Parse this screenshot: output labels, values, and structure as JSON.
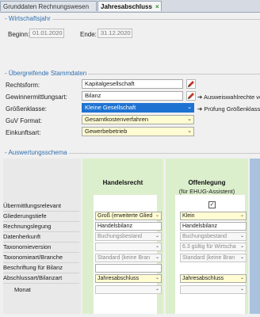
{
  "tabs": [
    {
      "label": "Grunddaten Rechnungswesen"
    },
    {
      "label": "Jahresabschluss"
    }
  ],
  "tab_close_glyph": "×",
  "fiscal_year": {
    "title": "Wirtschaftsjahr",
    "begin_label": "Beginn:",
    "begin_value": "01.01.2020",
    "end_label": "Ende:",
    "end_value": "31.12.2020"
  },
  "master_data": {
    "title": "Übergreifende Stammdaten",
    "rechtsform_label": "Rechtsform:",
    "rechtsform_value": "Kapitalgesellschaft",
    "gewinn_label": "Gewinnermittlungsart:",
    "gewinn_value": "Bilanz",
    "gewinn_hint": "Ausweiswahlrechte ver",
    "groesse_label": "Größenklasse:",
    "groesse_value": "Kleine Gesellschaft",
    "groesse_hint": "Prüfung Größenklasse:",
    "guv_label": "GuV Format:",
    "guv_value": "Gesamtkostenverfahren",
    "einkunft_label": "Einkunftsart:",
    "einkunft_value": "Gewerbebetrieb"
  },
  "schema": {
    "title": "Auswertungsschema",
    "col1_title": "Handelsrecht",
    "col2_title": "Offenlegung",
    "col2_subtitle": "(für EHUG-Assistent)",
    "rows": [
      {
        "label": "Übermittlungsrelevant"
      },
      {
        "label": "Gliederungstiefe"
      },
      {
        "label": "Rechnungslegung"
      },
      {
        "label": "Datenherkunft"
      },
      {
        "label": "Taxonomieversion"
      },
      {
        "label": "Taxonomieart/Branche"
      },
      {
        "label": "Beschriftung für Bilanz"
      },
      {
        "label": "Abschlussart/Bilanzart"
      },
      {
        "label": "Monat"
      }
    ],
    "hr": {
      "gliederung": "Groß (erweiterte Glied",
      "rechnungslegung": "Handelsbilanz",
      "datenherkunft": "Buchungsbestand",
      "taxonomieart": "Standard (keine Bran",
      "abschlussart": "Jahresabschluss"
    },
    "off": {
      "checked_glyph": "✓",
      "gliederung": "Klein",
      "rechnungslegung": "Handelsbilanz",
      "datenherkunft": "Buchungsbestand",
      "taxonomieversion": "6.3 gültig für Wirtscha",
      "taxonomieart": "Standard (keine Bran",
      "abschlussart": "Jahresabschluss"
    }
  },
  "dropdown_glyph": "⌄",
  "colors": {
    "accent": "#2f6fb0",
    "column_green": "#dcefcd",
    "selected": "#1e73d2"
  }
}
